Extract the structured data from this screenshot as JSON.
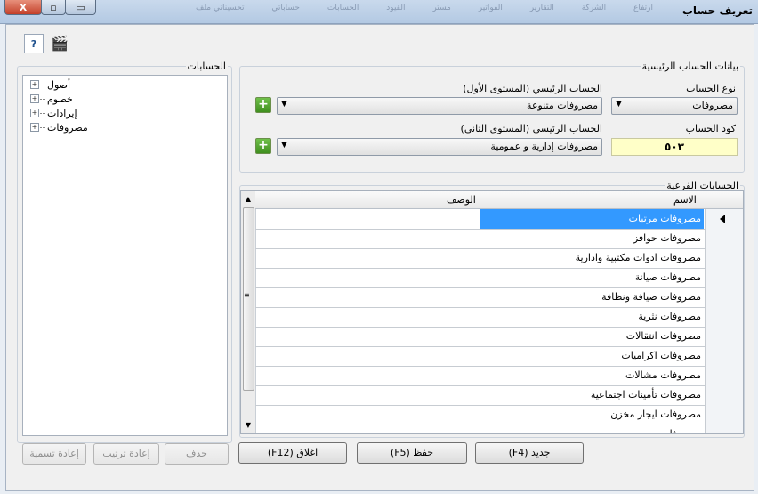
{
  "window": {
    "title": "تعريف حساب",
    "close_glyph": "X",
    "max_glyph": "▫",
    "min_glyph": "▭",
    "background_strip": [
      "ملف",
      "تحسيناتي",
      "حساباتي",
      "الحسابات",
      "القيود",
      "مستر",
      "الفواتير",
      "التقارير",
      "الشركة",
      "ارتفاع"
    ]
  },
  "toolbar": {
    "help_icon_glyph": "?",
    "video_icon_glyph": "🎬"
  },
  "accounts_tree": {
    "legend": "الحسابات",
    "expand_glyph": "+",
    "items": [
      {
        "label": "أصول"
      },
      {
        "label": "خصوم"
      },
      {
        "label": "إيرادات"
      },
      {
        "label": "مصروفات"
      }
    ]
  },
  "main_data": {
    "legend": "بيانات الحساب الرئيسية",
    "account_type_label": "نوع الحساب",
    "account_type_value": "مصروفات",
    "level1_label": "الحساب الرئيسي (المستوى الأول)",
    "level1_value": "مصروفات متنوعة",
    "account_code_label": "كود الحساب",
    "account_code_value": "٥٠٣",
    "level2_label": "الحساب الرئيسي (المستوى الثاني)",
    "level2_value": "مصروفات إدارية و عمومية",
    "combo_arrow_glyph": "▼",
    "plus_glyph": "+"
  },
  "sub_accounts": {
    "legend": "الحسابات الفرعية",
    "col_name": "الاسم",
    "col_desc": "الوصف",
    "scroll_up_glyph": "▲",
    "scroll_down_glyph": "▼",
    "scroll_grip_glyph": "≡",
    "rows": [
      {
        "name": "مصروفات مرتبات",
        "desc": ""
      },
      {
        "name": "مصروفات حوافز",
        "desc": ""
      },
      {
        "name": "مصروفات ادوات مكتبية وادارية",
        "desc": ""
      },
      {
        "name": "مصروفات صيانة",
        "desc": ""
      },
      {
        "name": "مصروفات ضيافة ونظافة",
        "desc": ""
      },
      {
        "name": "مصروفات نثرية",
        "desc": ""
      },
      {
        "name": "مصروفات انتقالات",
        "desc": ""
      },
      {
        "name": "مصروفات اكراميات",
        "desc": ""
      },
      {
        "name": "مصروفات مشالات",
        "desc": ""
      },
      {
        "name": "مصروفات تأمينات اجتماعية",
        "desc": ""
      },
      {
        "name": "مصروفات ايجار مخزن",
        "desc": ""
      },
      {
        "name": "مصروفات ...",
        "desc": ""
      }
    ],
    "selected_index": 0
  },
  "buttons": {
    "delete": "حذف",
    "reorder": "إعادة ترتيب",
    "rename": "إعادة تسمية",
    "new": "جديد (F4)",
    "save": "حفظ (F5)",
    "close": "اغلاق (F12)"
  },
  "colors": {
    "selection": "#3399ff",
    "code_field": "#ffffc8",
    "plus_button": "#4caa2b"
  }
}
